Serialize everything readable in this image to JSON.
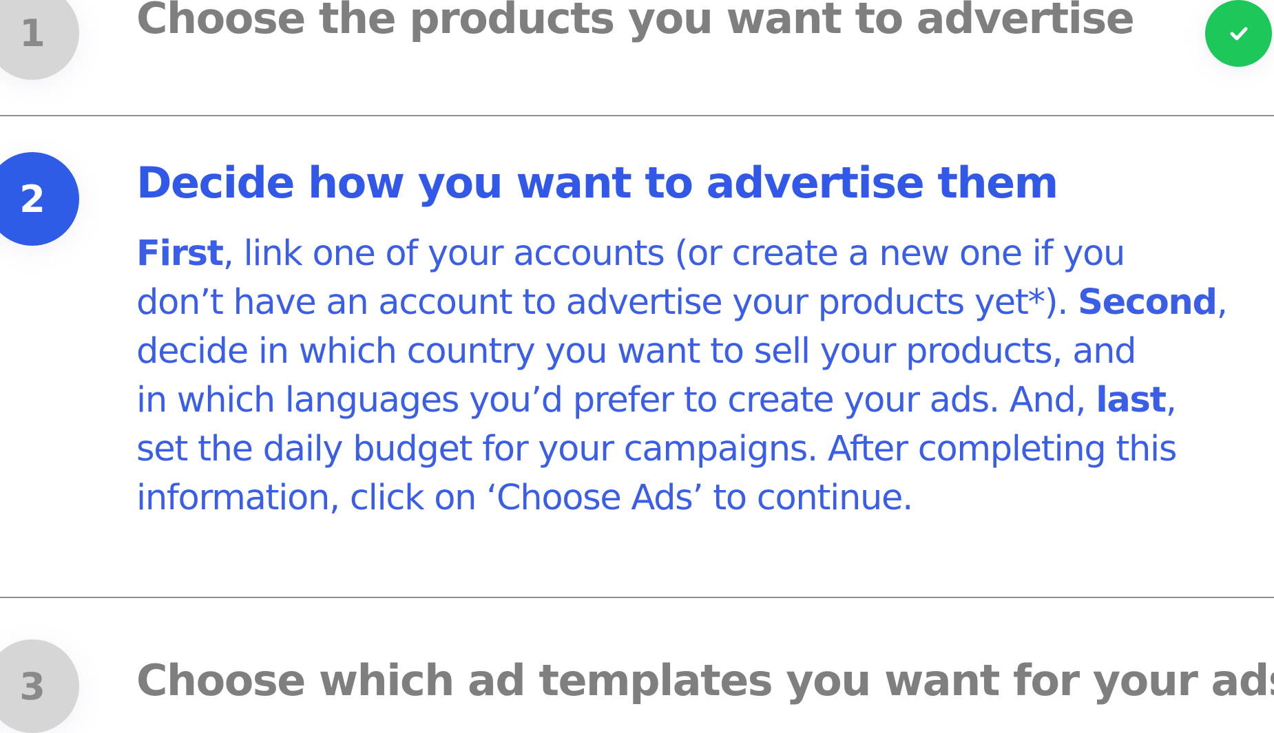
{
  "steps": [
    {
      "number": "1",
      "title": "Choose the products you want to advertise",
      "status": "completed"
    },
    {
      "number": "2",
      "title": "Decide how you want to advertise them",
      "status": "active",
      "description": {
        "line1_bold": "First",
        "line1_rest": ", link one of your accounts (or create a new one if you",
        "line2_start": "don’t have an account to advertise your products yet*). ",
        "line2_bold": "Second",
        "line2_end": ",",
        "line3": "decide in which country you want to sell your products, and",
        "line4_start": "in which languages you’d prefer to create your ads. And, ",
        "line4_bold": "last",
        "line4_end": ",",
        "line5": "set the daily budget for your campaigns. After completing this",
        "line6": "information, click on ‘Choose Ads’ to continue."
      }
    },
    {
      "number": "3",
      "title": "Choose which ad templates you want for your ads",
      "status": "pending"
    }
  ],
  "icons": {
    "completed": "check-icon"
  },
  "colors": {
    "active_blue": "#2e5ce6",
    "completed_green": "#1ec75a",
    "inactive_gray": "#d6d6d6",
    "inactive_text": "#7f7f7f"
  }
}
